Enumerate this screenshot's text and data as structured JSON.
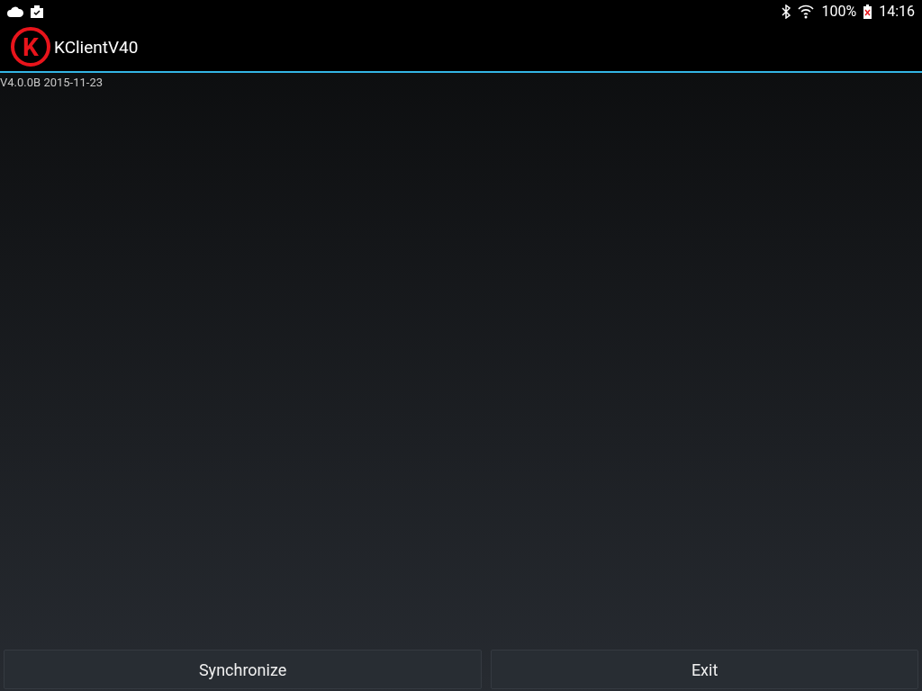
{
  "status_bar": {
    "battery": "100%",
    "time": "14:16"
  },
  "action_bar": {
    "logo_letter": "K",
    "title": "KClientV40"
  },
  "version": "V4.0.0B 2015-11-23",
  "buttons": [
    "Synchronize",
    "Exit"
  ]
}
